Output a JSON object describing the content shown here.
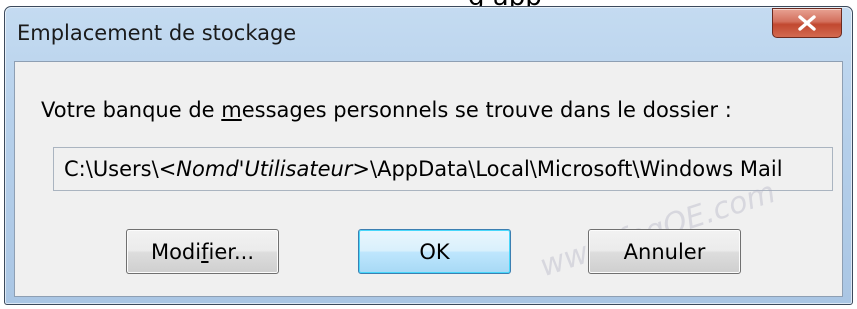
{
  "top_strip_text": "g app",
  "window": {
    "title": "Emplacement de stockage",
    "close_label": "X"
  },
  "dialog": {
    "prompt_before": "Votre banque de ",
    "prompt_mnemonic": "m",
    "prompt_after": "essages personnels se trouve dans le dossier :",
    "path_prefix": "C:\\Users\\",
    "path_user_token": "<Nomd'Utilisateur>",
    "path_suffix": "\\AppData\\Local\\Microsoft\\Windows Mail"
  },
  "buttons": {
    "modify_before": "Modi",
    "modify_mnemonic": "f",
    "modify_after": "ier...",
    "ok": "OK",
    "cancel": "Annuler"
  },
  "watermark": "www.faqOE.com",
  "colors": {
    "title_bar": "#b6d0eb",
    "close_button": "#c14830",
    "dialog_background": "#f0f0f0",
    "default_button_border": "#3c7fb1"
  }
}
